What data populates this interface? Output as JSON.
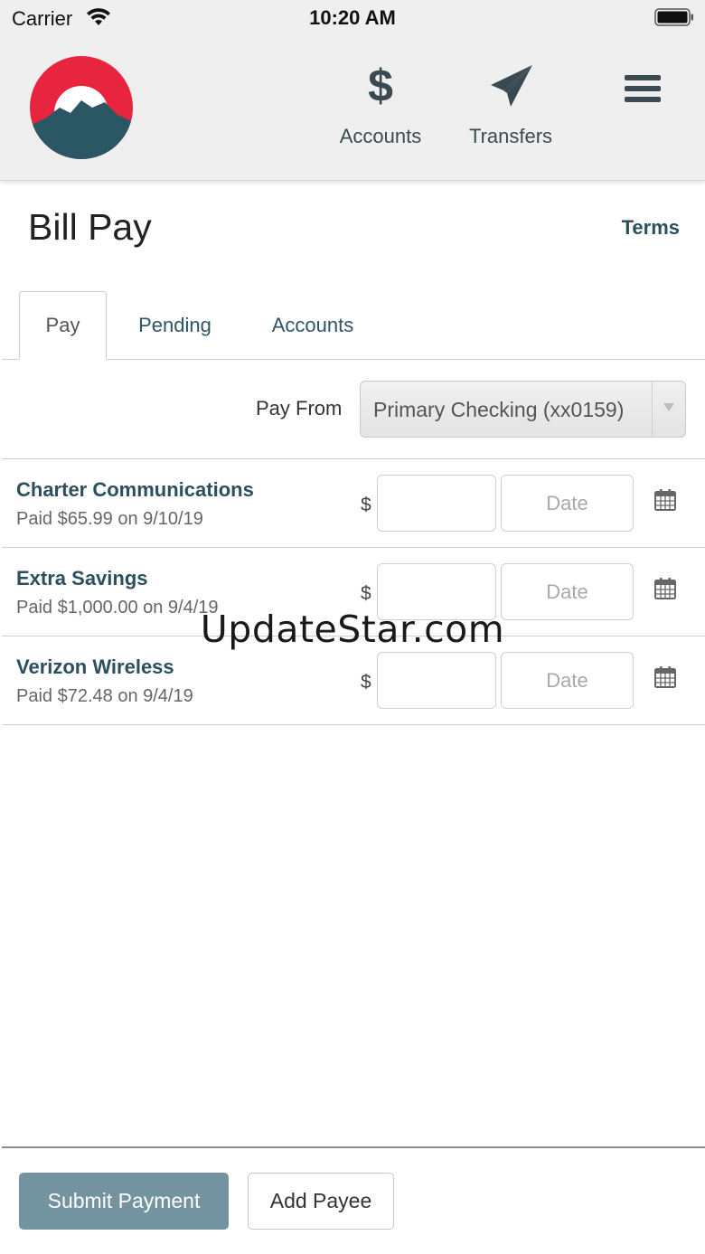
{
  "status_bar": {
    "carrier": "Carrier",
    "time": "10:20 AM",
    "icons": [
      "wifi-icon",
      "battery-icon"
    ]
  },
  "header": {
    "logo_icon": "mountain-sun-logo",
    "nav": [
      {
        "label": "Accounts",
        "icon": "dollar-icon"
      },
      {
        "label": "Transfers",
        "icon": "paper-plane-icon"
      }
    ],
    "menu_icon": "hamburger-menu-icon"
  },
  "page": {
    "title": "Bill Pay",
    "terms_label": "Terms"
  },
  "tabs": [
    {
      "label": "Pay",
      "active": true
    },
    {
      "label": "Pending",
      "active": false
    },
    {
      "label": "Accounts",
      "active": false
    }
  ],
  "pay_from": {
    "label": "Pay From",
    "selected": "Primary Checking (xx0159)"
  },
  "payees": [
    {
      "name": "Charter Communications",
      "last_payment": "Paid $65.99 on 9/10/19",
      "currency": "$",
      "amount": "",
      "date_placeholder": "Date"
    },
    {
      "name": "Extra Savings",
      "last_payment": "Paid $1,000.00 on 9/4/19",
      "currency": "$",
      "amount": "",
      "date_placeholder": "Date"
    },
    {
      "name": "Verizon Wireless",
      "last_payment": "Paid $72.48 on 9/4/19",
      "currency": "$",
      "amount": "",
      "date_placeholder": "Date"
    }
  ],
  "watermark": "UpdateStar.com",
  "footer": {
    "submit_label": "Submit Payment",
    "add_payee_label": "Add Payee"
  },
  "colors": {
    "brand_red": "#e8253f",
    "brand_teal": "#2b5664",
    "link": "#2c4f5e",
    "submit_bg": "#7393a0",
    "header_bg": "#efefef"
  }
}
